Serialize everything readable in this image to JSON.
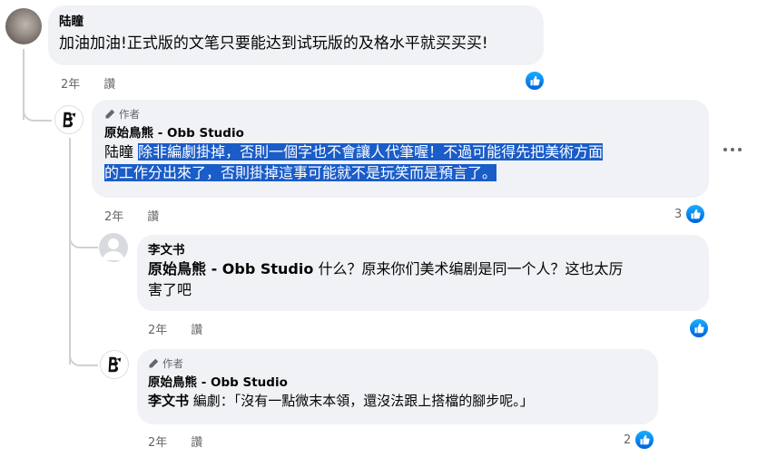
{
  "comments": [
    {
      "author": "陆瞳",
      "text": "加油加油!正式版的文笔只要能达到试玩版的及格水平就买买买!",
      "time": "2年",
      "action": "讚",
      "reactions": ""
    },
    {
      "badge": "作者",
      "author": "原始鳥熊 - Obb Studio",
      "mention": "陆瞳",
      "text_line1": "除非編劇掛掉，否則一個字也不會讓人代筆喔！不過可能得先把美術方面",
      "text_line2": "的工作分出來了，否則掛掉這事可能就不是玩笑而是預言了。",
      "time": "2年",
      "action": "讚",
      "reactions": "3"
    },
    {
      "author": "李文书",
      "mention": "原始鳥熊 - Obb Studio",
      "text_line1": " 什么？原来你们美术编剧是同一个人？这也太厉",
      "text_line2": "害了吧",
      "time": "2年",
      "action": "讚",
      "reactions": ""
    },
    {
      "badge": "作者",
      "author": "原始鳥熊 - Obb Studio",
      "mention": "李文书",
      "text": " 編劇：「沒有一點微末本領，還沒法跟上搭檔的腳步呢。」",
      "time": "2年",
      "action": "讚",
      "reactions": "2"
    }
  ],
  "icons": {
    "like": "thumbs-up-icon",
    "pen": "pen-icon",
    "more": "more-horizontal-icon",
    "logo": "obb-studio-logo"
  },
  "colors": {
    "bubble": "#f0f2f5",
    "selection": "#1a5cc8",
    "like_blue": "#0866ff",
    "meta_gray": "#65676b"
  }
}
